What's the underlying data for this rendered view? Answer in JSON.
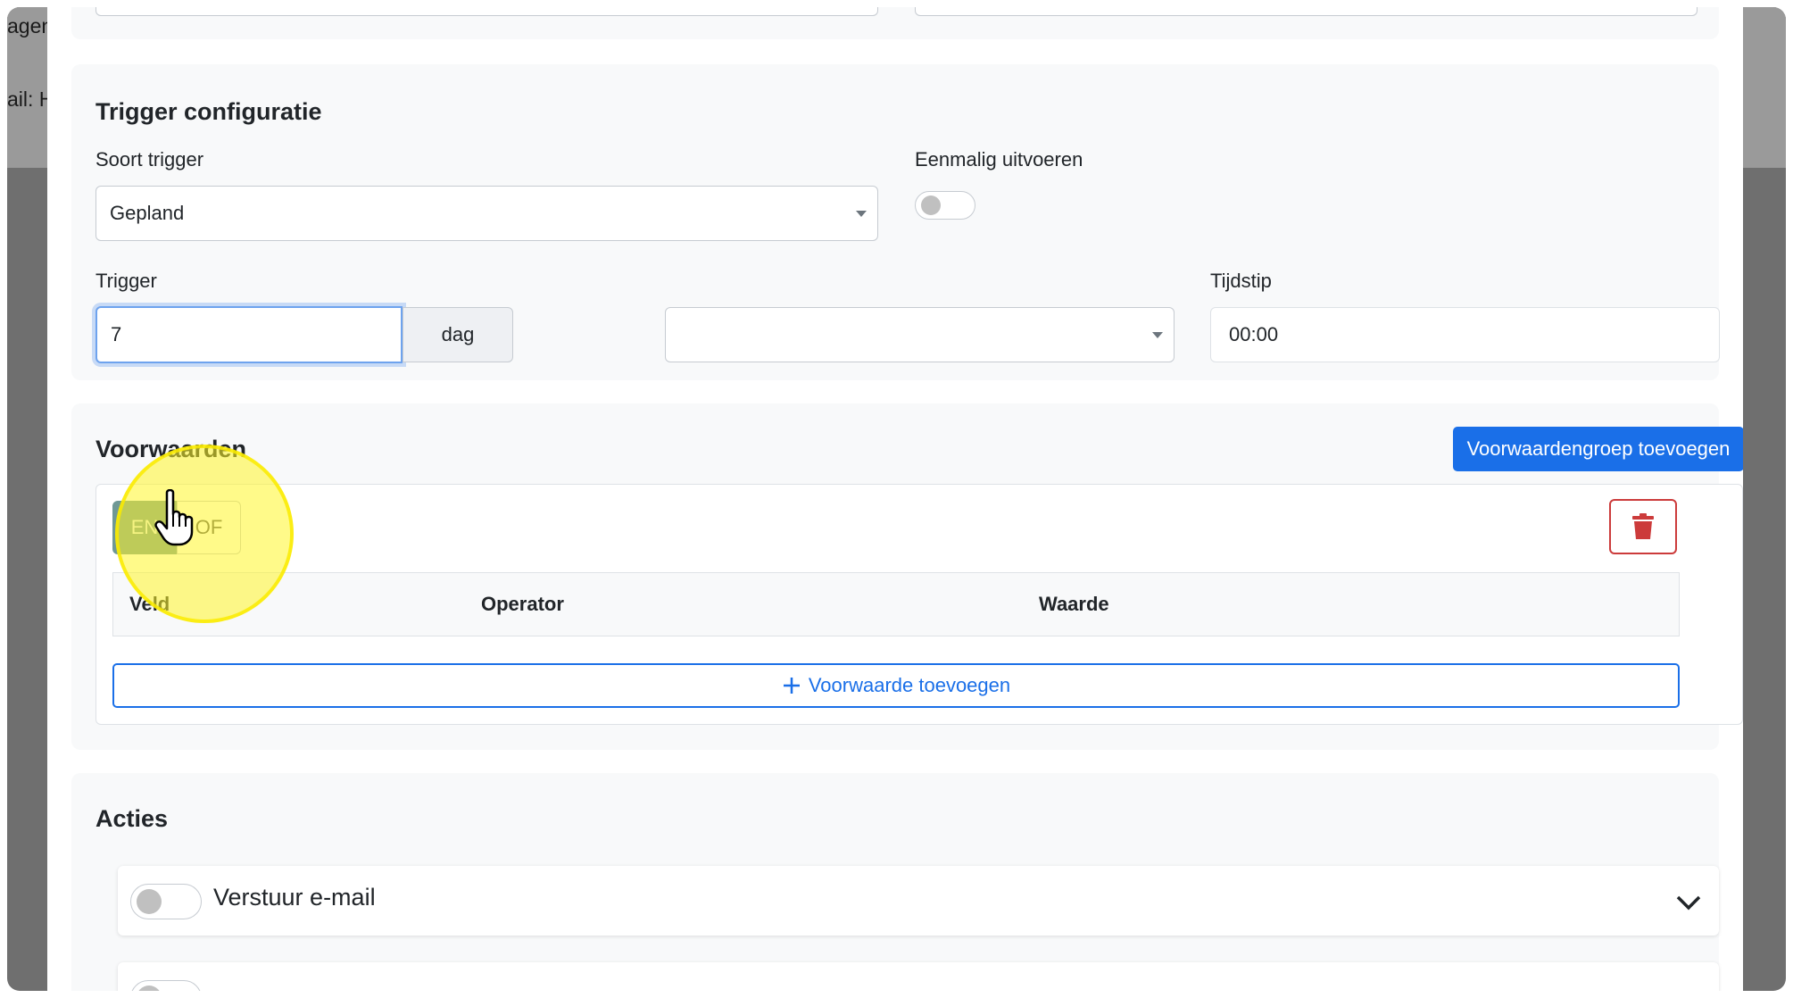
{
  "background": {
    "text_top": "agen",
    "text_mid": "ail: H"
  },
  "trigger_config": {
    "title": "Trigger configuratie",
    "type_label": "Soort trigger",
    "type_value": "Gepland",
    "once_label": "Eenmalig uitvoeren",
    "once_enabled": false,
    "trigger_label": "Trigger",
    "trigger_value": "7",
    "trigger_unit": "dag",
    "relative_value": "",
    "time_label": "Tijdstip",
    "time_value": "00:00"
  },
  "conditions": {
    "title": "Voorwaarden",
    "add_group_label": "Voorwaardengroep toevoegen",
    "operator_and": "EN",
    "operator_or": "OF",
    "selected_operator": "EN",
    "columns": [
      "Veld",
      "Operator",
      "Waarde"
    ],
    "add_condition_label": "Voorwaarde toevoegen"
  },
  "actions": {
    "title": "Acties",
    "items": [
      {
        "label": "Verstuur e-mail",
        "enabled": false
      },
      {
        "label": "",
        "enabled": false
      }
    ]
  },
  "icons": {
    "delete": "trash-icon",
    "add": "plus-icon",
    "expand": "chevron-down-icon",
    "cursor": "hand-pointer-icon"
  },
  "colors": {
    "primary": "#1a6fe8",
    "danger": "#cc3b3b",
    "active_segment": "#6f9895",
    "highlight": "#fff528"
  }
}
